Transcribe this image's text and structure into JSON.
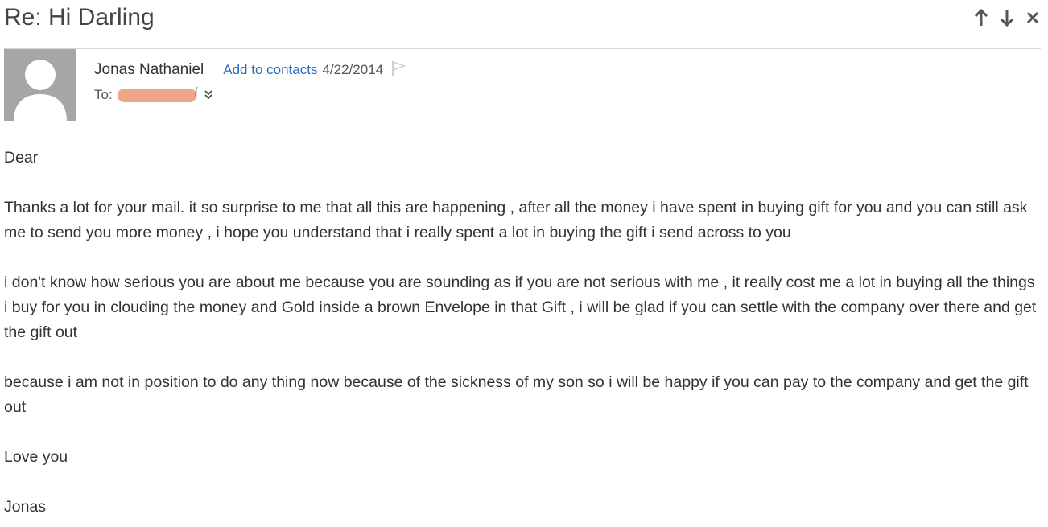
{
  "message": {
    "subject": "Re: Hi Darling",
    "sender_name": "Jonas Nathaniel",
    "add_to_contacts_label": "Add to contacts",
    "date": "4/22/2014",
    "to_label": "To:",
    "recipient_tail": "í"
  },
  "body": {
    "greeting": "Dear",
    "paragraph_1": "Thanks a lot for your  mail. it so surprise to me  that all this are happening , after all the money i have spent in buying gift for you and you can still ask me to send you more money , i hope you understand that i really spent a lot in buying the gift i send across to you",
    "paragraph_2": "i don't know how serious you are about me because you are sounding as if you are not serious with me , it really cost me a lot in buying all the things i buy for you in clouding the money and Gold inside a brown Envelope in that Gift , i will be glad if you can settle with the company over there and get the gift out",
    "paragraph_3": "because i am not in position to do any thing now because of the sickness of my son so i will be happy if you can pay to the company and get the gift out",
    "closing": "Love you",
    "signature": "Jonas"
  },
  "icons": {
    "previous": "arrow-up-icon",
    "next": "arrow-down-icon",
    "close": "close-icon",
    "flag": "flag-icon",
    "expand": "double-chevron-down-icon",
    "avatar": "person-silhouette"
  },
  "colors": {
    "link": "#2a6ebb",
    "avatar_bg": "#a6a6a6",
    "redaction": "#f0a488"
  }
}
